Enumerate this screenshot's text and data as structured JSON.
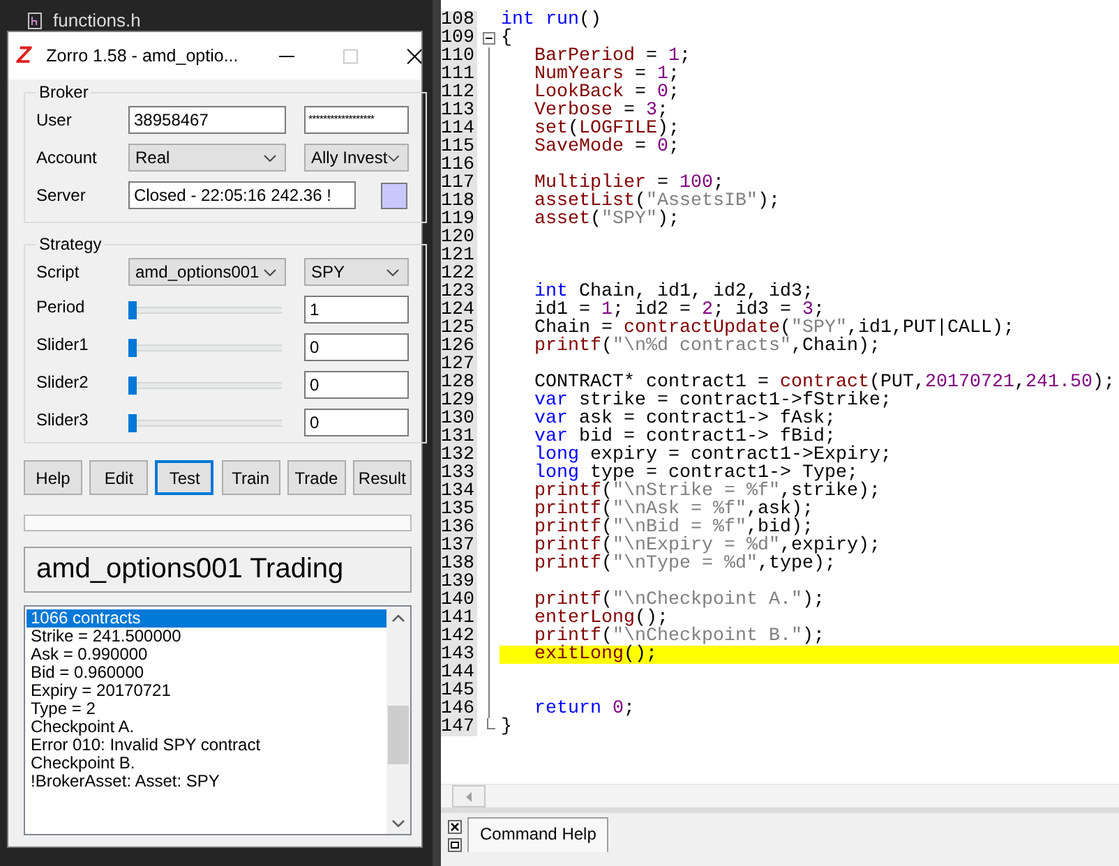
{
  "background": {
    "files": [
      {
        "name": "functions.h"
      }
    ]
  },
  "zorro_window": {
    "logo": "Z",
    "title": "Zorro 1.58 - amd_optio...",
    "broker": {
      "legend": "Broker",
      "user": {
        "label": "User",
        "value": "38958467",
        "password": "******************"
      },
      "account": {
        "label": "Account",
        "value": "Real",
        "broker": "Ally Invest"
      },
      "server": {
        "label": "Server",
        "value": "Closed - 22:05:16   242.36 !"
      }
    },
    "strategy": {
      "legend": "Strategy",
      "script": {
        "label": "Script",
        "value": "amd_options001",
        "asset": "SPY"
      },
      "sliders": [
        {
          "label": "Period",
          "level": 0,
          "value": "1"
        },
        {
          "label": "Slider1",
          "level": 0,
          "value": "0"
        },
        {
          "label": "Slider2",
          "level": 0,
          "value": "0"
        },
        {
          "label": "Slider3",
          "level": 0,
          "value": "0"
        }
      ]
    },
    "buttons": [
      {
        "label": "Help",
        "focused": false
      },
      {
        "label": "Edit",
        "focused": false
      },
      {
        "label": "Test",
        "focused": true
      },
      {
        "label": "Train",
        "focused": false
      },
      {
        "label": "Trade",
        "focused": false
      },
      {
        "label": "Result",
        "focused": false
      }
    ],
    "progress": {
      "level": 0
    },
    "status": "amd_options001 Trading",
    "log": [
      {
        "text": "1066 contracts",
        "selected": true
      },
      {
        "text": "Strike = 241.500000",
        "selected": false
      },
      {
        "text": "Ask = 0.990000",
        "selected": false
      },
      {
        "text": "Bid = 0.960000",
        "selected": false
      },
      {
        "text": "Expiry = 20170721",
        "selected": false
      },
      {
        "text": "Type = 2",
        "selected": false
      },
      {
        "text": "Checkpoint A.",
        "selected": false
      },
      {
        "text": "Error 010: Invalid SPY contract",
        "selected": false
      },
      {
        "text": "Checkpoint B.",
        "selected": false
      },
      {
        "text": "!BrokerAsset: Asset: SPY",
        "selected": false
      }
    ]
  },
  "editor": {
    "lines": [
      {
        "number": "108",
        "tokens": [
          {
            "kind": "keyword",
            "text": "int run"
          },
          {
            "kind": "plain",
            "text": "()"
          }
        ]
      },
      {
        "number": "109",
        "tokens": [
          {
            "kind": "plain",
            "text": "{"
          }
        ],
        "children": [
          {
            "number": "110",
            "tokens": [
              {
                "kind": "function",
                "text": "BarPeriod"
              },
              {
                "kind": "plain",
                "text": " = "
              },
              {
                "kind": "number",
                "text": "1"
              },
              {
                "kind": "plain",
                "text": ";"
              }
            ]
          },
          {
            "number": "111",
            "tokens": [
              {
                "kind": "function",
                "text": "NumYears"
              },
              {
                "kind": "plain",
                "text": " = "
              },
              {
                "kind": "number",
                "text": "1"
              },
              {
                "kind": "plain",
                "text": ";"
              }
            ]
          },
          {
            "number": "112",
            "tokens": [
              {
                "kind": "function",
                "text": "LookBack"
              },
              {
                "kind": "plain",
                "text": " = "
              },
              {
                "kind": "number",
                "text": "0"
              },
              {
                "kind": "plain",
                "text": ";"
              }
            ]
          },
          {
            "number": "113",
            "tokens": [
              {
                "kind": "function",
                "text": "Verbose"
              },
              {
                "kind": "plain",
                "text": " = "
              },
              {
                "kind": "number",
                "text": "3"
              },
              {
                "kind": "plain",
                "text": ";"
              }
            ]
          },
          {
            "number": "114",
            "tokens": [
              {
                "kind": "function",
                "text": "set"
              },
              {
                "kind": "plain",
                "text": "("
              },
              {
                "kind": "function",
                "text": "LOGFILE"
              },
              {
                "kind": "plain",
                "text": ");"
              }
            ]
          },
          {
            "number": "115",
            "tokens": [
              {
                "kind": "function",
                "text": "SaveMode"
              },
              {
                "kind": "plain",
                "text": " = "
              },
              {
                "kind": "number",
                "text": "0"
              },
              {
                "kind": "plain",
                "text": ";"
              }
            ]
          },
          {
            "number": "116"
          },
          {
            "number": "117",
            "tokens": [
              {
                "kind": "function",
                "text": "Multiplier"
              },
              {
                "kind": "plain",
                "text": " = "
              },
              {
                "kind": "number",
                "text": "100"
              },
              {
                "kind": "plain",
                "text": ";"
              }
            ]
          },
          {
            "number": "118",
            "tokens": [
              {
                "kind": "function",
                "text": "assetList"
              },
              {
                "kind": "plain",
                "text": "("
              },
              {
                "kind": "string",
                "text": "\"AssetsIB\""
              },
              {
                "kind": "plain",
                "text": ");"
              }
            ]
          },
          {
            "number": "119",
            "tokens": [
              {
                "kind": "function",
                "text": "asset"
              },
              {
                "kind": "plain",
                "text": "("
              },
              {
                "kind": "string",
                "text": "\"SPY\""
              },
              {
                "kind": "plain",
                "text": ");"
              }
            ]
          },
          {
            "number": "120"
          },
          {
            "number": "121"
          },
          {
            "number": "122"
          },
          {
            "number": "123",
            "tokens": [
              {
                "kind": "keyword",
                "text": "int"
              },
              {
                "kind": "plain",
                "text": " Chain, id1, id2, id3;"
              }
            ]
          },
          {
            "number": "124",
            "tokens": [
              {
                "kind": "plain",
                "text": "id1 = "
              },
              {
                "kind": "number",
                "text": "1"
              },
              {
                "kind": "plain",
                "text": "; id2 = "
              },
              {
                "kind": "number",
                "text": "2"
              },
              {
                "kind": "plain",
                "text": "; id3 = "
              },
              {
                "kind": "number",
                "text": "3"
              },
              {
                "kind": "plain",
                "text": ";"
              }
            ]
          },
          {
            "number": "125",
            "tokens": [
              {
                "kind": "plain",
                "text": "Chain = "
              },
              {
                "kind": "function",
                "text": "contractUpdate"
              },
              {
                "kind": "plain",
                "text": "("
              },
              {
                "kind": "string",
                "text": "\"SPY\""
              },
              {
                "kind": "plain",
                "text": ",id1,PUT|CALL);"
              }
            ]
          },
          {
            "number": "126",
            "tokens": [
              {
                "kind": "function",
                "text": "printf"
              },
              {
                "kind": "plain",
                "text": "("
              },
              {
                "kind": "string",
                "text": "\"\\n%d contracts\""
              },
              {
                "kind": "plain",
                "text": ",Chain);"
              }
            ]
          },
          {
            "number": "127"
          },
          {
            "number": "128",
            "tokens": [
              {
                "kind": "plain",
                "text": "CONTRACT* contract1 = "
              },
              {
                "kind": "function",
                "text": "contract"
              },
              {
                "kind": "plain",
                "text": "(PUT,"
              },
              {
                "kind": "number",
                "text": "20170721"
              },
              {
                "kind": "plain",
                "text": ","
              },
              {
                "kind": "number",
                "text": "241.50"
              },
              {
                "kind": "plain",
                "text": ");"
              }
            ]
          },
          {
            "number": "129",
            "tokens": [
              {
                "kind": "keyword",
                "text": "var"
              },
              {
                "kind": "plain",
                "text": " strike = contract1->fStrike;"
              }
            ]
          },
          {
            "number": "130",
            "tokens": [
              {
                "kind": "keyword",
                "text": "var"
              },
              {
                "kind": "plain",
                "text": " ask = contract1-> fAsk;"
              }
            ]
          },
          {
            "number": "131",
            "tokens": [
              {
                "kind": "keyword",
                "text": "var"
              },
              {
                "kind": "plain",
                "text": " bid = contract1-> fBid;"
              }
            ]
          },
          {
            "number": "132",
            "tokens": [
              {
                "kind": "keyword",
                "text": "long"
              },
              {
                "kind": "plain",
                "text": " expiry = contract1->Expiry;"
              }
            ]
          },
          {
            "number": "133",
            "tokens": [
              {
                "kind": "keyword",
                "text": "long"
              },
              {
                "kind": "plain",
                "text": " type = contract1-> Type;"
              }
            ]
          },
          {
            "number": "134",
            "tokens": [
              {
                "kind": "function",
                "text": "printf"
              },
              {
                "kind": "plain",
                "text": "("
              },
              {
                "kind": "string",
                "text": "\"\\nStrike = %f\""
              },
              {
                "kind": "plain",
                "text": ",strike);"
              }
            ]
          },
          {
            "number": "135",
            "tokens": [
              {
                "kind": "function",
                "text": "printf"
              },
              {
                "kind": "plain",
                "text": "("
              },
              {
                "kind": "string",
                "text": "\"\\nAsk = %f\""
              },
              {
                "kind": "plain",
                "text": ",ask);"
              }
            ]
          },
          {
            "number": "136",
            "tokens": [
              {
                "kind": "function",
                "text": "printf"
              },
              {
                "kind": "plain",
                "text": "("
              },
              {
                "kind": "string",
                "text": "\"\\nBid = %f\""
              },
              {
                "kind": "plain",
                "text": ",bid);"
              }
            ]
          },
          {
            "number": "137",
            "tokens": [
              {
                "kind": "function",
                "text": "printf"
              },
              {
                "kind": "plain",
                "text": "("
              },
              {
                "kind": "string",
                "text": "\"\\nExpiry = %d\""
              },
              {
                "kind": "plain",
                "text": ",expiry);"
              }
            ]
          },
          {
            "number": "138",
            "tokens": [
              {
                "kind": "function",
                "text": "printf"
              },
              {
                "kind": "plain",
                "text": "("
              },
              {
                "kind": "string",
                "text": "\"\\nType = %d\""
              },
              {
                "kind": "plain",
                "text": ",type);"
              }
            ]
          },
          {
            "number": "139"
          },
          {
            "number": "140",
            "tokens": [
              {
                "kind": "function",
                "text": "printf"
              },
              {
                "kind": "plain",
                "text": "("
              },
              {
                "kind": "string",
                "text": "\"\\nCheckpoint A.\""
              },
              {
                "kind": "plain",
                "text": ");"
              }
            ]
          },
          {
            "number": "141",
            "tokens": [
              {
                "kind": "function",
                "text": "enterLong"
              },
              {
                "kind": "plain",
                "text": "();"
              }
            ]
          },
          {
            "number": "142",
            "tokens": [
              {
                "kind": "function",
                "text": "printf"
              },
              {
                "kind": "plain",
                "text": "("
              },
              {
                "kind": "string",
                "text": "\"\\nCheckpoint B.\""
              },
              {
                "kind": "plain",
                "text": ");"
              }
            ]
          },
          {
            "number": "143",
            "highlighted": true,
            "tokens": [
              {
                "kind": "function",
                "text": "exitLong"
              },
              {
                "kind": "plain",
                "text": "();"
              }
            ]
          },
          {
            "number": "144"
          },
          {
            "number": "145"
          },
          {
            "number": "146",
            "tokens": [
              {
                "kind": "keyword",
                "text": "return"
              },
              {
                "kind": "number",
                "text": " 0"
              },
              {
                "kind": "plain",
                "text": ";"
              }
            ]
          }
        ]
      },
      {
        "number": "147",
        "tokens": [
          {
            "kind": "plain",
            "text": "}"
          }
        ]
      }
    ],
    "panel_tabs": [
      {
        "label": "Command Help",
        "selected": true
      }
    ]
  }
}
